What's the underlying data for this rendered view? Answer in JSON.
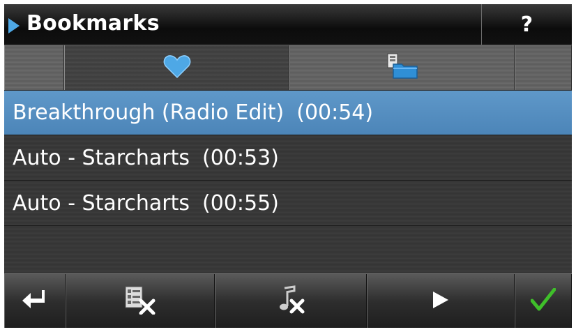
{
  "titlebar": {
    "title": "Bookmarks",
    "help_label": "?"
  },
  "tabs": [
    {
      "name": "favorites",
      "icon": "heart-icon",
      "active": true
    },
    {
      "name": "folders",
      "icon": "folder-icon",
      "active": false
    }
  ],
  "list": {
    "items": [
      {
        "title": "Breakthrough (Radio Edit)",
        "duration": "(00:54)",
        "selected": true
      },
      {
        "title": "Auto - Starcharts",
        "duration": "(00:53)",
        "selected": false
      },
      {
        "title": "Auto - Starcharts",
        "duration": "(00:55)",
        "selected": false
      }
    ]
  },
  "toolbar": {
    "buttons": [
      "back-icon",
      "delete-list-icon",
      "delete-track-icon",
      "play-icon",
      "confirm-icon"
    ]
  },
  "colors": {
    "accent": "#4ea8e6",
    "selection": "#568fc1",
    "confirm": "#3fbf2a"
  }
}
